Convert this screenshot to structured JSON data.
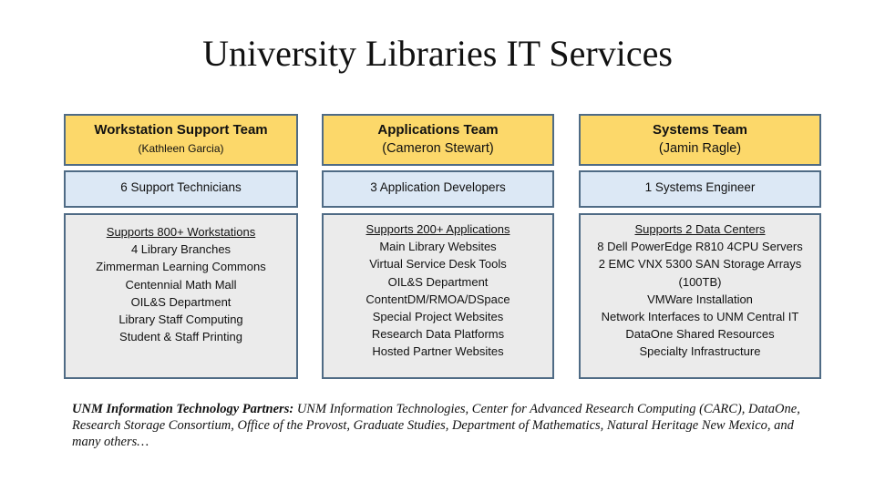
{
  "title": "University Libraries IT Services",
  "teams": [
    {
      "name": "Workstation Support Team",
      "lead": "(Kathleen Garcia)",
      "staff": "6 Support Technicians",
      "heading": "Supports 800+ Workstations",
      "items": [
        "4 Library Branches",
        "Zimmerman Learning Commons",
        "Centennial Math Mall",
        "OIL&S Department",
        "Library Staff Computing",
        "Student & Staff Printing"
      ]
    },
    {
      "name": "Applications Team",
      "lead": "(Cameron Stewart)",
      "staff": "3 Application Developers",
      "heading": "Supports 200+ Applications",
      "items": [
        "Main Library Websites",
        "Virtual Service Desk Tools",
        "OIL&S Department",
        "ContentDM/RMOA/DSpace",
        "Special Project Websites",
        "Research Data Platforms",
        "Hosted Partner Websites"
      ]
    },
    {
      "name": "Systems Team",
      "lead": "(Jamin Ragle)",
      "staff": "1 Systems Engineer",
      "heading": "Supports 2 Data Centers",
      "items": [
        "8 Dell PowerEdge R810 4CPU Servers",
        "2 EMC VNX 5300 SAN Storage Arrays",
        "(100TB)",
        "VMWare Installation",
        "Network Interfaces to UNM Central IT",
        "DataOne Shared Resources",
        "Specialty Infrastructure"
      ]
    }
  ],
  "partners": {
    "label": "UNM Information Technology Partners:",
    "text": " UNM Information Technologies, Center for Advanced Research Computing (CARC), DataOne, Research Storage Consortium, Office of the Provost, Graduate Studies, Department of Mathematics, Natural Heritage New Mexico, and many others…"
  },
  "colors": {
    "header_fill": "#fcd86a",
    "staff_fill": "#dce8f5",
    "details_fill": "#ebebeb",
    "border": "#4f6b85"
  }
}
